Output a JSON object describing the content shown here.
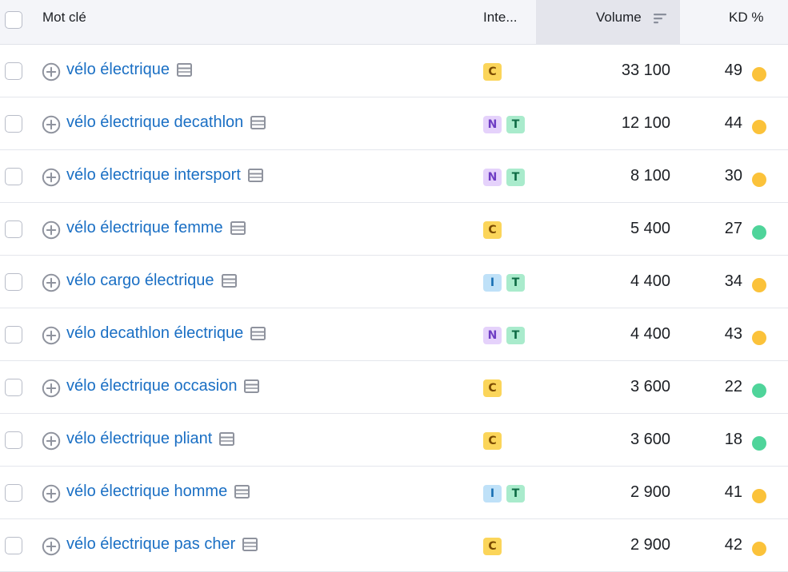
{
  "header": {
    "keyword": "Mot clé",
    "intent": "Inte...",
    "volume": "Volume",
    "kd": "KD %"
  },
  "colors": {
    "kd_orange": "#fbc23a",
    "kd_green": "#4fd49a",
    "link": "#1a6fc4"
  },
  "rows": [
    {
      "keyword": "vélo électrique",
      "intents": [
        "C"
      ],
      "volume": "33 100",
      "kd": "49",
      "kd_level": "orange"
    },
    {
      "keyword": "vélo électrique decathlon",
      "intents": [
        "N",
        "T"
      ],
      "volume": "12 100",
      "kd": "44",
      "kd_level": "orange"
    },
    {
      "keyword": "vélo électrique intersport",
      "intents": [
        "N",
        "T"
      ],
      "volume": "8 100",
      "kd": "30",
      "kd_level": "orange"
    },
    {
      "keyword": "vélo électrique femme",
      "intents": [
        "C"
      ],
      "volume": "5 400",
      "kd": "27",
      "kd_level": "green"
    },
    {
      "keyword": "vélo cargo électrique",
      "intents": [
        "I",
        "T"
      ],
      "volume": "4 400",
      "kd": "34",
      "kd_level": "orange"
    },
    {
      "keyword": "vélo decathlon électrique",
      "intents": [
        "N",
        "T"
      ],
      "volume": "4 400",
      "kd": "43",
      "kd_level": "orange"
    },
    {
      "keyword": "vélo électrique occasion",
      "intents": [
        "C"
      ],
      "volume": "3 600",
      "kd": "22",
      "kd_level": "green"
    },
    {
      "keyword": "vélo électrique pliant",
      "intents": [
        "C"
      ],
      "volume": "3 600",
      "kd": "18",
      "kd_level": "green"
    },
    {
      "keyword": "vélo électrique homme",
      "intents": [
        "I",
        "T"
      ],
      "volume": "2 900",
      "kd": "41",
      "kd_level": "orange"
    },
    {
      "keyword": "vélo électrique pas cher",
      "intents": [
        "C"
      ],
      "volume": "2 900",
      "kd": "42",
      "kd_level": "orange"
    }
  ]
}
